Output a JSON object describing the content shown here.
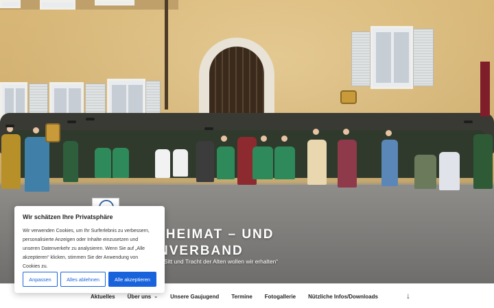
{
  "site": {
    "title_line1": "E – HEIMAT – UND",
    "title_line2": "NVERBAND",
    "tagline": "„Sitt und Tracht der Alten wollen wir erhalten“",
    "logo_icon": "association-seal-icon"
  },
  "nav": {
    "items": [
      {
        "label": "Aktuelles"
      },
      {
        "label": "Über uns",
        "has_dropdown": true
      },
      {
        "label": "Unsere Gaujugend"
      },
      {
        "label": "Termine"
      },
      {
        "label": "Fotogallerie"
      },
      {
        "label": "Nützliche Infos/Downloads"
      }
    ],
    "scroll_icon": "arrow-down-icon",
    "caret_glyph": "⌄",
    "scroll_glyph": "↓"
  },
  "cookie_banner": {
    "title": "Wir schätzen Ihre Privatsphäre",
    "text": "Wir verwenden Cookies, um Ihr Surferlebnis zu verbessern, personalisierte Anzeigen oder Inhalte einzusetzen und unseren Datenverkehr zu analysieren. Wenn Sie auf „Alle akzeptieren“ klicken, stimmen Sie der Anwendung von Cookies zu.",
    "customize_label": "Anpassen",
    "reject_label": "Alles ablehnen",
    "accept_label": "Alle akzeptieren",
    "accent_color": "#1863dc"
  }
}
